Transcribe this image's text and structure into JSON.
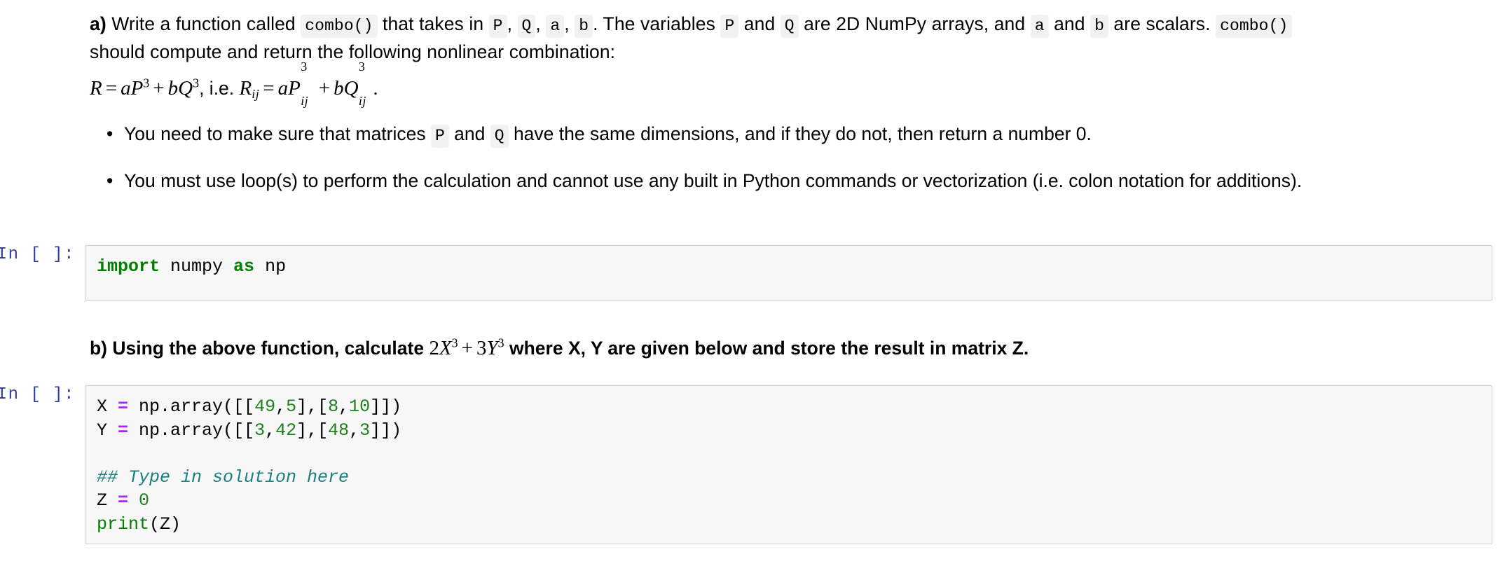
{
  "notebook": {
    "markdown_a": {
      "label": "a)",
      "line1_parts": [
        {
          "type": "text",
          "value": " Write a function called "
        },
        {
          "type": "code",
          "value": "combo()"
        },
        {
          "type": "text",
          "value": " that takes in "
        },
        {
          "type": "code",
          "value": "P"
        },
        {
          "type": "text",
          "value": ", "
        },
        {
          "type": "code",
          "value": "Q"
        },
        {
          "type": "text",
          "value": ", "
        },
        {
          "type": "code",
          "value": "a"
        },
        {
          "type": "text",
          "value": ", "
        },
        {
          "type": "code",
          "value": "b"
        },
        {
          "type": "text",
          "value": ". The variables "
        },
        {
          "type": "code",
          "value": "P"
        },
        {
          "type": "text",
          "value": " and "
        },
        {
          "type": "code",
          "value": "Q"
        },
        {
          "type": "text",
          "value": " are 2D NumPy arrays, and "
        },
        {
          "type": "code",
          "value": "a"
        },
        {
          "type": "text",
          "value": " and "
        },
        {
          "type": "code",
          "value": "b"
        },
        {
          "type": "text",
          "value": " are scalars. "
        },
        {
          "type": "code",
          "value": "combo()"
        }
      ],
      "line1_text_plain": "a) Write a function called combo() that takes in P, Q, a, b. The variables P and Q are 2D NumPy arrays, and a and b are scalars. combo()",
      "line2": "should compute and return the following nonlinear combination:",
      "equation_plain": "R = aP^3 + bQ^3, i.e. R_ij = aP^3_ij + bQ^3_ij.",
      "equation": {
        "lhs_var": "R",
        "equals": "=",
        "coef_a": "a",
        "var_P": "P",
        "exp_P": "3",
        "plus": "+",
        "coef_b": "b",
        "var_Q": "Q",
        "exp_Q": "3",
        "comma_ie": ", i.e. ",
        "lhs_var2": "R",
        "sub2": "ij",
        "period": "."
      },
      "bullets": [
        {
          "bullet_glyph": "•",
          "parts": [
            {
              "type": "text",
              "value": "You need to make sure that matrices "
            },
            {
              "type": "code",
              "value": "P"
            },
            {
              "type": "text",
              "value": " and "
            },
            {
              "type": "code",
              "value": "Q"
            },
            {
              "type": "text",
              "value": " have the same dimensions, and if they do not, then return a number 0."
            }
          ],
          "text_plain": "You need to make sure that matrices P and Q have the same dimensions, and if they do not, then return a number 0."
        },
        {
          "bullet_glyph": "•",
          "parts": [
            {
              "type": "text",
              "value": "You must use loop(s) to perform the calculation and cannot use any built in Python commands or vectorization (i.e. colon notation for additions)."
            }
          ],
          "text_plain": "You must use loop(s) to perform the calculation and cannot use any built in Python commands or vectorization (i.e. colon notation for additions)."
        }
      ]
    },
    "cell1": {
      "prompt": "In [ ]:",
      "source_plain": "import numpy as np",
      "tokens": [
        {
          "t": "kw",
          "v": "import"
        },
        {
          "t": "plain",
          "v": " numpy "
        },
        {
          "t": "kw",
          "v": "as"
        },
        {
          "t": "plain",
          "v": " np"
        }
      ]
    },
    "markdown_b": {
      "label": "b)",
      "text_before": " Using the above function, calculate ",
      "math_plain": "2X^3 + 3Y^3",
      "math": {
        "coef1": "2",
        "var1": "X",
        "exp1": "3",
        "plus": "+",
        "coef2": "3",
        "var2": "Y",
        "exp2": "3"
      },
      "text_after": " where X, Y are given below and store the result in matrix Z.",
      "text_plain": "b) Using the above function, calculate 2X^3 + 3Y^3 where X, Y are given below and store the result in matrix Z."
    },
    "cell2": {
      "prompt": "In [ ]:",
      "source_plain": "X = np.array([[49,5],[8,10]])\nY = np.array([[3,42],[48,3]])\n\n## Type in solution here\nZ = 0\nprint(Z)",
      "lines": [
        {
          "tokens": [
            {
              "t": "plain",
              "v": "X "
            },
            {
              "t": "op",
              "v": "="
            },
            {
              "t": "plain",
              "v": " np.array([["
            },
            {
              "t": "num",
              "v": "49"
            },
            {
              "t": "plain",
              "v": ","
            },
            {
              "t": "num",
              "v": "5"
            },
            {
              "t": "plain",
              "v": "],["
            },
            {
              "t": "num",
              "v": "8"
            },
            {
              "t": "plain",
              "v": ","
            },
            {
              "t": "num",
              "v": "10"
            },
            {
              "t": "plain",
              "v": "]])"
            }
          ]
        },
        {
          "tokens": [
            {
              "t": "plain",
              "v": "Y "
            },
            {
              "t": "op",
              "v": "="
            },
            {
              "t": "plain",
              "v": " np.array([["
            },
            {
              "t": "num",
              "v": "3"
            },
            {
              "t": "plain",
              "v": ","
            },
            {
              "t": "num",
              "v": "42"
            },
            {
              "t": "plain",
              "v": "],["
            },
            {
              "t": "num",
              "v": "48"
            },
            {
              "t": "plain",
              "v": ","
            },
            {
              "t": "num",
              "v": "3"
            },
            {
              "t": "plain",
              "v": "]])"
            }
          ]
        },
        {
          "tokens": [
            {
              "t": "plain",
              "v": ""
            }
          ]
        },
        {
          "tokens": [
            {
              "t": "comment",
              "v": "## Type in solution here"
            }
          ]
        },
        {
          "tokens": [
            {
              "t": "plain",
              "v": "Z "
            },
            {
              "t": "op",
              "v": "="
            },
            {
              "t": "plain",
              "v": " "
            },
            {
              "t": "num",
              "v": "0"
            }
          ]
        },
        {
          "tokens": [
            {
              "t": "builtin",
              "v": "print"
            },
            {
              "t": "plain",
              "v": "(Z)"
            }
          ]
        }
      ]
    }
  },
  "colors": {
    "cell_background": "#f7f7f7",
    "cell_border": "#cfcfcf",
    "prompt_text": "#303f9f",
    "keyword": "#008000",
    "number": "#208020",
    "operator": "#aa22ff",
    "comment": "#1a8080",
    "inline_code_chip_bg": "#f2f2f2",
    "page_background": "#ffffff"
  }
}
